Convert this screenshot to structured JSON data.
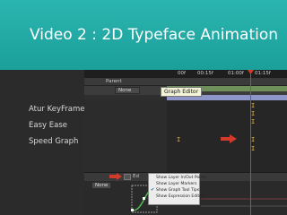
{
  "slide": {
    "title": "Video 2 : 2D Typeface Animation",
    "bullets": [
      "Atur KeyFrame",
      "Easy Ease",
      "Speed Graph"
    ],
    "accent": "#1fa9a4"
  },
  "screenshot": {
    "ruler_ticks": [
      "00f",
      "00:15f",
      "01:00f",
      "01:15f"
    ],
    "layer_header": "Parent",
    "parent_value": "None",
    "tooltip": "Graph Editor",
    "graph_toolbar_label": "Ed",
    "graph_parent_value": "None",
    "menu_items": [
      "Show Layer In/Out Points",
      "Show Layer Markers",
      "Show Graph Tool Tips",
      "Show Expression Editor"
    ],
    "menu_checked_index": 2,
    "keyframe_glyph": "I",
    "colors": {
      "playhead": "#d23a2c",
      "keyframe": "#e8b33a",
      "layer_bar": "#8d95c9"
    }
  }
}
